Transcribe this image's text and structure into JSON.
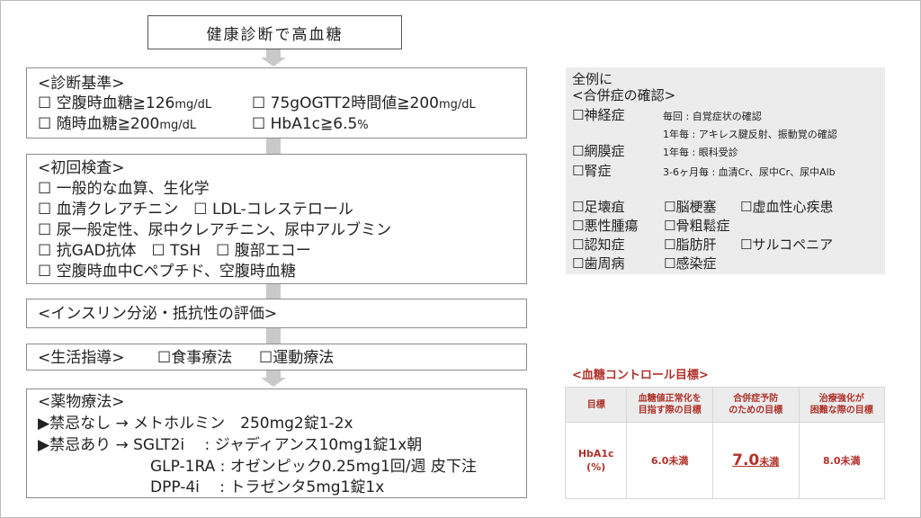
{
  "title": "健康診断で高血糖",
  "criteria": {
    "heading": "<診断基準>",
    "items": [
      "☐ 空腹時血糖≧126",
      "mg/dL",
      "☐ 75gOGTT2時間値≧200",
      "mg/dL",
      "☐ 随時血糖≧200",
      "mg/dL",
      "☐ HbA1c≧6.5",
      "%"
    ]
  },
  "initial": {
    "heading": "<初回検査>",
    "lines": [
      "☐ 一般的な血算、生化学",
      "☐ 血清クレアチニン　☐ LDL-コレステロール",
      "☐ 尿一般定性、尿中クレアチニン、尿中アルブミン",
      "☐ 抗GAD抗体　☐ TSH　☐ 腹部エコー",
      "☐ 空腹時血中Cペプチド、空腹時血糖"
    ]
  },
  "insulin": "<インスリン分泌・抵抗性の評価>",
  "lifestyle": {
    "heading": "<生活指導>",
    "items": [
      "☐食事療法",
      "☐運動療法"
    ]
  },
  "drug": {
    "heading": "<薬物療法>",
    "lines": [
      "▶禁忌なし → メトホルミン　250mg2錠1-2x",
      "▶禁忌あり → SGLT2i　 : ジャディアンス10mg1錠1x朝",
      "GLP-1RA : オゼンピック0.25mg1回/週 皮下注",
      "DPP-4i　 : トラゼンタ5mg1錠1x"
    ]
  },
  "complications": {
    "line1": "全例に",
    "line2": "<合併症の確認>",
    "items": [
      {
        "name": "☐神経症",
        "note1": "毎回 : 自覚症状の確認",
        "note2": "1年毎 : アキレス腱反射、振動覚の確認"
      },
      {
        "name": "☐網膜症",
        "note1": "1年毎 : 眼科受診"
      },
      {
        "name": "☐腎症",
        "note1": "3-6ヶ月毎 : 血清Cr、尿中Cr、尿中Alb"
      }
    ],
    "grid": [
      [
        "☐足壊疽",
        "☐脳梗塞",
        "☐虚血性心疾患"
      ],
      [
        "☐悪性腫瘍",
        "☐骨粗鬆症"
      ],
      [
        "☐認知症",
        "☐脂肪肝",
        "☐サルコペニア"
      ],
      [
        "☐歯周病",
        "☐感染症"
      ]
    ]
  },
  "goal": {
    "title": "<血糖コントロール目標>",
    "headers": [
      "目標",
      "血糖値正常化を目指す際の目標",
      "合併症予防のための目標",
      "治療強化が困難な際の目標"
    ],
    "row_label_1": "HbA1c",
    "row_label_2": "(%)",
    "values": [
      {
        "num": "6.0",
        "unit": "未満"
      },
      {
        "num": "7.0",
        "unit": "未満"
      },
      {
        "num": "8.0",
        "unit": "未満"
      }
    ]
  }
}
